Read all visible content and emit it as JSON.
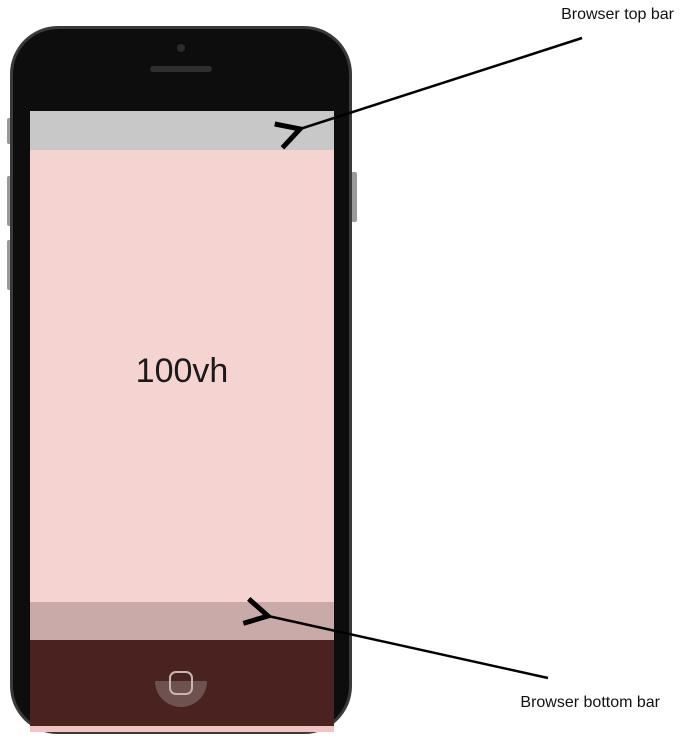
{
  "labels": {
    "viewport": "100vh",
    "top_bar": "Browser top bar",
    "bottom_bar": "Browser bottom bar"
  },
  "colors": {
    "phone_body": "#0d0d0d",
    "phone_frame": "#3a3a3a",
    "top_bar": "#c8c8c8",
    "viewport": "#f4d3d0",
    "bottom_bar": "#c9aaa8",
    "overflow_region": "#4a2220",
    "overflow_edge": "#f3c5c2",
    "arrow": "#000000"
  },
  "icons": {
    "home": "home-button-icon",
    "camera": "camera-icon",
    "speaker": "speaker-icon"
  }
}
